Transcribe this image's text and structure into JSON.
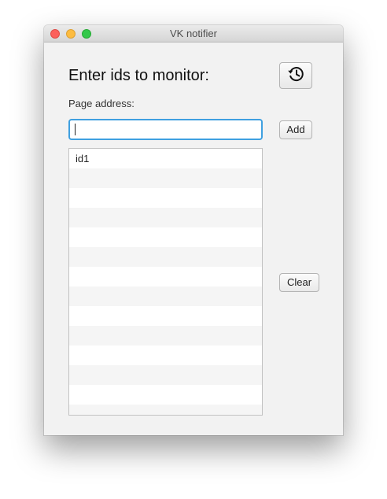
{
  "window": {
    "title": "VK notifier"
  },
  "main": {
    "heading": "Enter ids to monitor:",
    "history_button_icon": "history-icon",
    "page_address_label": "Page address:",
    "page_address_value": "",
    "add_label": "Add",
    "clear_label": "Clear",
    "ids": [
      "id1"
    ]
  },
  "colors": {
    "input_focus": "#3fa0e0",
    "close": "#fc605c",
    "minimize": "#fdbc40",
    "maximize": "#34c84a"
  }
}
